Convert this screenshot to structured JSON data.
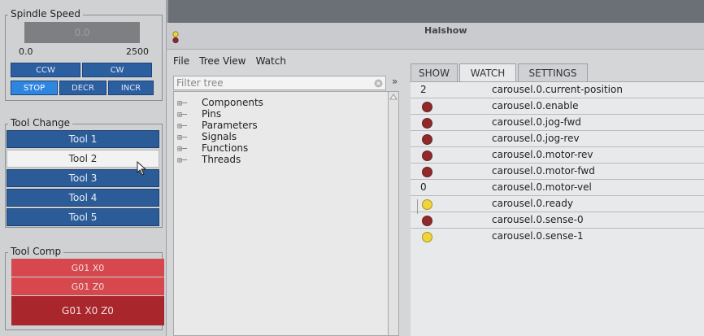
{
  "spindle": {
    "title": "Spindle Speed",
    "speed_value": "0.0",
    "min": "0.0",
    "max": "2500",
    "buttons": {
      "ccw": "CCW",
      "cw": "CW",
      "stop": "STOP",
      "decr": "DECR",
      "incr": "INCR"
    }
  },
  "tool_change": {
    "title": "Tool Change",
    "tools": [
      "Tool 1",
      "Tool 2",
      "Tool 3",
      "Tool 4",
      "Tool 5"
    ],
    "selected": "Tool 2"
  },
  "tool_comp": {
    "title": "Tool Comp",
    "buttons": [
      "G01 X0",
      "G01 Z0",
      "G01 X0 Z0"
    ]
  },
  "halshow": {
    "title": "Halshow",
    "menu": [
      "File",
      "Tree View",
      "Watch"
    ],
    "filter_placeholder": "Filter tree",
    "expand_glyph": "»",
    "tree": [
      "Components",
      "Pins",
      "Parameters",
      "Signals",
      "Functions",
      "Threads"
    ],
    "tabs": [
      "SHOW",
      "WATCH",
      "SETTINGS"
    ],
    "active_tab": "WATCH",
    "watch": [
      {
        "kind": "value",
        "value": "2",
        "name": "carousel.0.current-position"
      },
      {
        "kind": "led",
        "state": "off",
        "name": "carousel.0.enable"
      },
      {
        "kind": "led",
        "state": "off",
        "name": "carousel.0.jog-fwd"
      },
      {
        "kind": "led",
        "state": "off",
        "name": "carousel.0.jog-rev"
      },
      {
        "kind": "led",
        "state": "off",
        "name": "carousel.0.motor-rev"
      },
      {
        "kind": "led",
        "state": "off",
        "name": "carousel.0.motor-fwd"
      },
      {
        "kind": "value",
        "value": "0",
        "name": "carousel.0.motor-vel"
      },
      {
        "kind": "led",
        "state": "on",
        "name": "carousel.0.ready"
      },
      {
        "kind": "led",
        "state": "off",
        "name": "carousel.0.sense-0"
      },
      {
        "kind": "led",
        "state": "on",
        "name": "carousel.0.sense-1"
      }
    ]
  },
  "colors": {
    "led_off": "#8f2a2c",
    "led_on": "#f0d53a",
    "tool_button": "#2c5c98",
    "comp_button": "#d6474e"
  }
}
